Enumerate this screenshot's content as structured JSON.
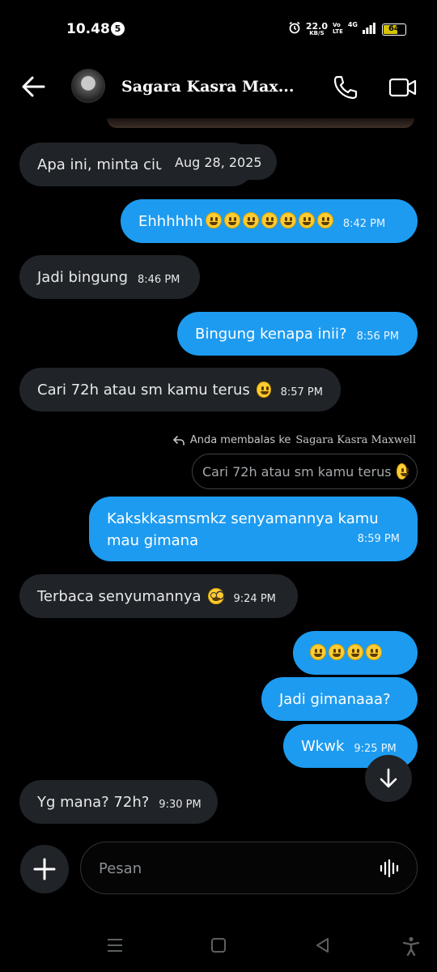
{
  "status_bar": {
    "time": "10.48",
    "notification_count": "5",
    "net_speed": "22.0",
    "net_unit": "KB/S",
    "volte_top": "Vo",
    "volte_bottom": "LTE",
    "network": "4G",
    "battery": "64"
  },
  "header": {
    "contact_name": "Sagara Kasra Max..."
  },
  "date_separator": "Aug 28, 2025",
  "messages": [
    {
      "dir": "in",
      "text": "Apa ini, minta ciu",
      "time": ""
    },
    {
      "dir": "out",
      "text": "Ehhhhhh",
      "emoji_count": 7,
      "time": "8:42 PM"
    },
    {
      "dir": "in",
      "text": "Jadi bingung",
      "time": "8:46 PM"
    },
    {
      "dir": "out",
      "text": "Bingung kenapa inii?",
      "time": "8:56 PM"
    },
    {
      "dir": "in",
      "text": "Cari 72h atau sm kamu terus",
      "emoji": "lol",
      "time": "8:57 PM"
    },
    {
      "dir": "out",
      "text_line1": "Kakskkasmsmkz senyamannya kamu",
      "text_line2": "mau gimana",
      "time": "8:59 PM"
    },
    {
      "dir": "in",
      "text": "Terbaca senyumannya",
      "emoji": "nerd",
      "time": "9:24 PM"
    },
    {
      "dir": "out",
      "text": "",
      "emoji_count": 4,
      "time": ""
    },
    {
      "dir": "out",
      "text": "Jadi gimanaaa?",
      "time": ""
    },
    {
      "dir": "out",
      "text": "Wkwk",
      "time": "9:25 PM"
    },
    {
      "dir": "in",
      "text": "Yg mana? 72h?",
      "time": "9:30 PM"
    }
  ],
  "reply": {
    "prefix": "Anda membalas ke",
    "name": "Sagara Kasra Maxwell",
    "quoted_text": "Cari 72h atau sm kamu terus"
  },
  "composer": {
    "placeholder": "Pesan"
  },
  "colors": {
    "background": "#000000",
    "incoming_bubble": "#202327",
    "outgoing_bubble": "#1d9bf0"
  }
}
